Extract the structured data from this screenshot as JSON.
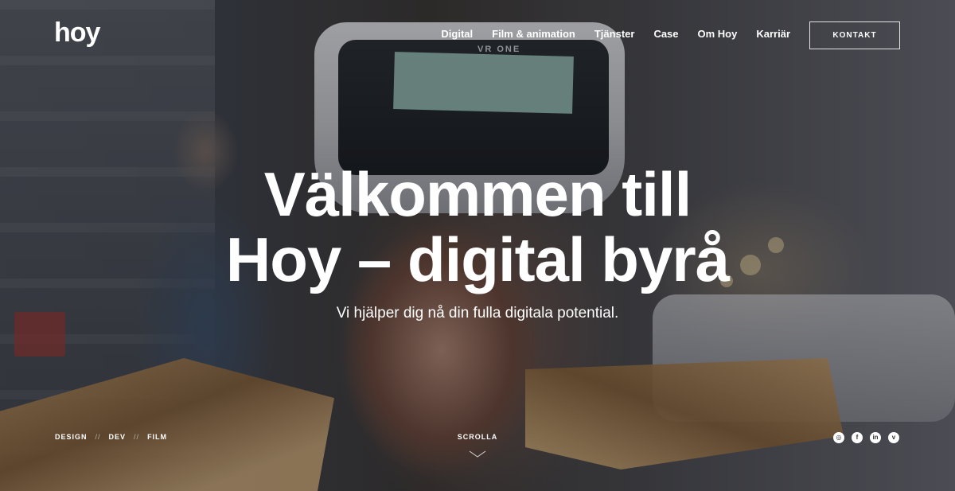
{
  "header": {
    "logo": "hoy",
    "nav": [
      {
        "label": "Digital"
      },
      {
        "label": "Film & animation"
      },
      {
        "label": "Tjänster"
      },
      {
        "label": "Case"
      },
      {
        "label": "Om Hoy"
      },
      {
        "label": "Karriär"
      }
    ],
    "contact_label": "KONTAKT"
  },
  "hero": {
    "headline_line1": "Välkommen till",
    "headline_line2": "Hoy – digital byrå",
    "subtitle": "Vi hjälper dig nå din fulla digitala potential.",
    "headset_text": "VR ONE"
  },
  "footer": {
    "tags": [
      "DESIGN",
      "DEV",
      "FILM"
    ],
    "separator": "//",
    "scroll_label": "SCROLLA",
    "social": [
      {
        "icon": "instagram-icon",
        "glyph": "◎"
      },
      {
        "icon": "facebook-icon",
        "glyph": "f"
      },
      {
        "icon": "linkedin-icon",
        "glyph": "in"
      },
      {
        "icon": "vimeo-icon",
        "glyph": "v"
      }
    ]
  }
}
